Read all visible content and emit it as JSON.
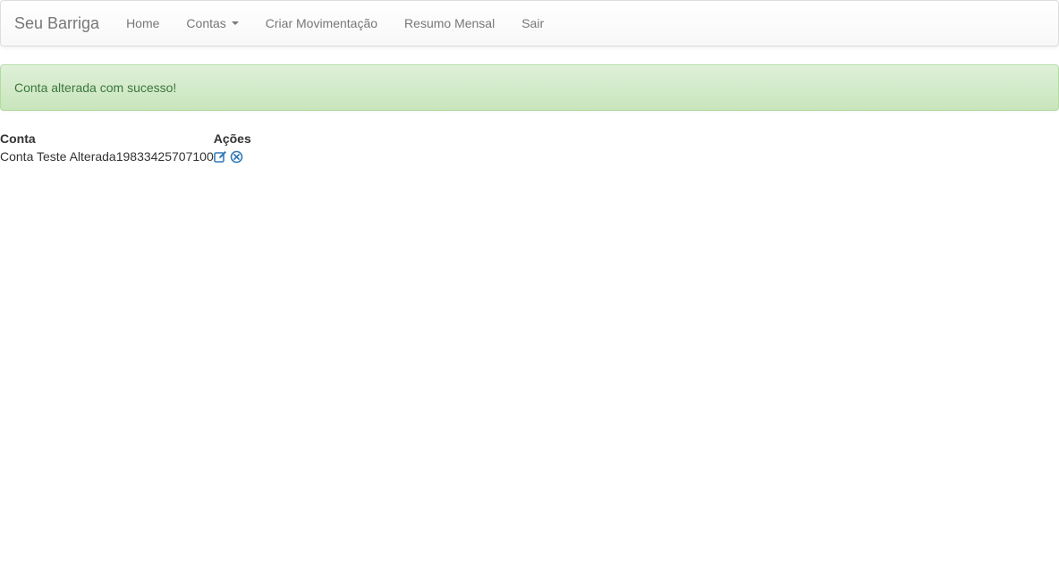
{
  "navbar": {
    "brand": "Seu Barriga",
    "items": [
      {
        "label": "Home"
      },
      {
        "label": "Contas",
        "has_dropdown": true
      },
      {
        "label": "Criar Movimentação"
      },
      {
        "label": "Resumo Mensal"
      },
      {
        "label": "Sair"
      }
    ]
  },
  "alert": {
    "message": "Conta alterada com sucesso!",
    "type": "success"
  },
  "table": {
    "headers": {
      "account": "Conta",
      "actions": "Ações"
    },
    "rows": [
      {
        "account": "Conta Teste Alterada19833425707100",
        "actions": [
          "edit-icon",
          "remove-icon"
        ]
      }
    ]
  },
  "colors": {
    "link_icon": "#337ab7",
    "alert_text": "#3c763d",
    "nav_text": "#777777"
  }
}
